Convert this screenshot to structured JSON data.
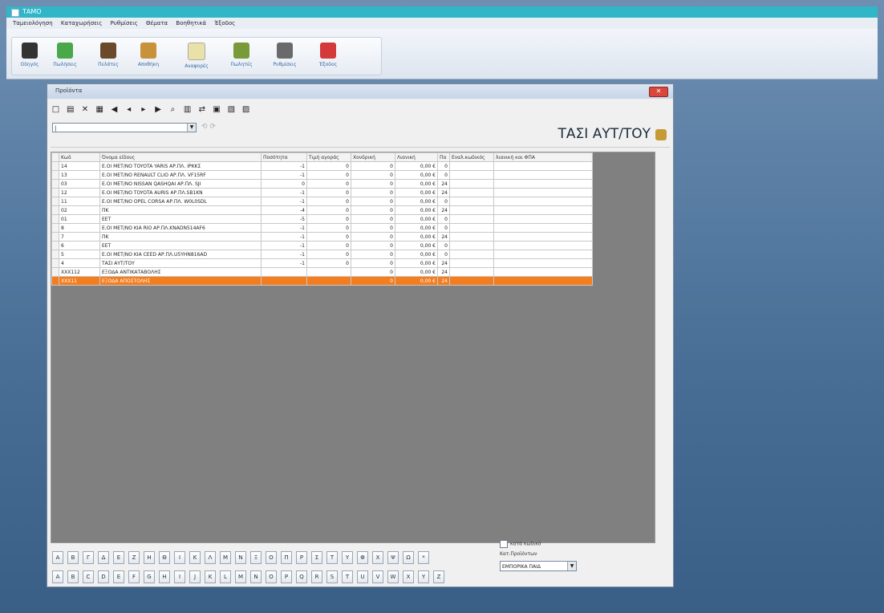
{
  "app": {
    "title": "ΤΑΜΟ"
  },
  "menu": [
    "Ταμειολόγηση",
    "Καταχωρήσεις",
    "Ρυθμίσεις",
    "Θέματα",
    "Βοηθητικά",
    "Έξοδος"
  ],
  "toolbar": [
    {
      "label": "Οδηγός",
      "icon": "top-hat-icon",
      "color": "#333"
    },
    {
      "label": "Πωλήσεις",
      "icon": "add-sale-icon",
      "color": "#4aa84a"
    },
    {
      "label": "Πελάτες",
      "icon": "customer-icon",
      "color": "#6a4a2a"
    },
    {
      "label": "Αποθήκη",
      "icon": "box-icon",
      "color": "#c8923a"
    },
    {
      "label": "Αναφορές",
      "icon": "report-icon",
      "color": "#e9e2a8"
    },
    {
      "label": "Πωλητές",
      "icon": "salesman-icon",
      "color": "#7a9a3a"
    },
    {
      "label": "Ρυθμίσεις",
      "icon": "settings-icon",
      "color": "#6a6a6a"
    },
    {
      "label": "Έξοδος",
      "icon": "exit-icon",
      "color": "#d43a3a"
    }
  ],
  "window": {
    "title": "Προϊόντα",
    "header_title": "ΤΑΣΙ ΑΥΤ/ΤΟΥ",
    "search_value": "|"
  },
  "grid": {
    "headers": [
      "Κωδ",
      "Όνομα είδους",
      "Ποσότητα",
      "Τιμή αγοράς",
      "Χονδρική",
      "Λιανική",
      "Πα",
      "Εναλ.κωδικός",
      "λιανική και ΦΠΑ"
    ],
    "rows": [
      [
        "14",
        "Ε.ΟΙ ΜΕΤ/ΝΟ TOYOTA YARIS ΑΡ.ΠΛ. ΙΡΚΚΣ",
        "-1",
        "0",
        "0",
        "0,00 €",
        "0",
        "",
        ""
      ],
      [
        "13",
        "Ε.ΟΙ ΜΕΤ/ΝΟ RENAULT CLIO ΑΡ.ΠΛ. VF15RF",
        "-1",
        "0",
        "0",
        "0,00 €",
        "0",
        "",
        ""
      ],
      [
        "03",
        "Ε.ΟΙ ΜΕΤ/ΝΟ NISSAN QASHQAI ΑΡ.ΠΛ. SJI",
        "0",
        "0",
        "0",
        "0,00 €",
        "24",
        "",
        ""
      ],
      [
        "12",
        "Ε.ΟΙ ΜΕΤ/ΝΟ TOYOTA AURIS ΑΡ.ΠΛ.SB1KN",
        "-1",
        "0",
        "0",
        "0,00 €",
        "24",
        "",
        ""
      ],
      [
        "11",
        "Ε.ΟΙ ΜΕΤ/ΝΟ OPEL CORSA ΑΡ.ΠΛ. W0L0SDL",
        "-1",
        "0",
        "0",
        "0,00 €",
        "0",
        "",
        ""
      ],
      [
        "02",
        "ΠΚ",
        "-4",
        "0",
        "0",
        "0,00 €",
        "24",
        "",
        ""
      ],
      [
        "01",
        "ΕΕΤ",
        "-5",
        "0",
        "0",
        "0,00 €",
        "0",
        "",
        ""
      ],
      [
        "8",
        "Ε.ΟΙ ΜΕΤ/ΝΟ KIA RIO ΑΡ.ΠΛ.KNADN514AF6",
        "-1",
        "0",
        "0",
        "0,00 €",
        "0",
        "",
        ""
      ],
      [
        "7",
        "ΠΚ",
        "-1",
        "0",
        "0",
        "0,00 €",
        "24",
        "",
        ""
      ],
      [
        "6",
        "ΕΕΤ",
        "-1",
        "0",
        "0",
        "0,00 €",
        "0",
        "",
        ""
      ],
      [
        "5",
        "Ε.ΟΙ ΜΕΤ/ΝΟ KIA CEED ΑΡ.ΠΛ.U5YHN816AD",
        "-1",
        "0",
        "0",
        "0,00 €",
        "0",
        "",
        ""
      ],
      [
        "4",
        "ΤΑΣΙ ΑΥΤ/ΤΟΥ",
        "-1",
        "0",
        "0",
        "0,00 €",
        "24",
        "",
        ""
      ],
      [
        "XXX112",
        "ΕΞΟΔΑ ΑΝΤΙΚΑΤΑΒΟΛΗΣ",
        "",
        "",
        "0",
        "0,00 €",
        "24",
        "",
        ""
      ],
      [
        "XXX11",
        "ΕΞΟΔΑ ΑΠΟΣΤΟΛΗΣ",
        "",
        "",
        "0",
        "0,00 €",
        "24",
        "",
        ""
      ]
    ],
    "selected_row": 13
  },
  "letters_greek": [
    "Α",
    "Β",
    "Γ",
    "Δ",
    "Ε",
    "Ζ",
    "Η",
    "Θ",
    "Ι",
    "Κ",
    "Λ",
    "Μ",
    "Ν",
    "Ξ",
    "Ο",
    "Π",
    "Ρ",
    "Σ",
    "Τ",
    "Υ",
    "Φ",
    "Χ",
    "Ψ",
    "Ω",
    "*"
  ],
  "letters_latin": [
    "A",
    "B",
    "C",
    "D",
    "E",
    "F",
    "G",
    "H",
    "I",
    "J",
    "K",
    "L",
    "M",
    "N",
    "O",
    "P",
    "Q",
    "R",
    "S",
    "T",
    "U",
    "V",
    "W",
    "X",
    "Y",
    "Z"
  ],
  "options": {
    "code_checkbox_label": "κατά κωδικό",
    "category_label": "Κατ.Προϊόντων",
    "category_value": "ΕΜΠΟΡΙΚΑ ΠΑΙΔ"
  }
}
